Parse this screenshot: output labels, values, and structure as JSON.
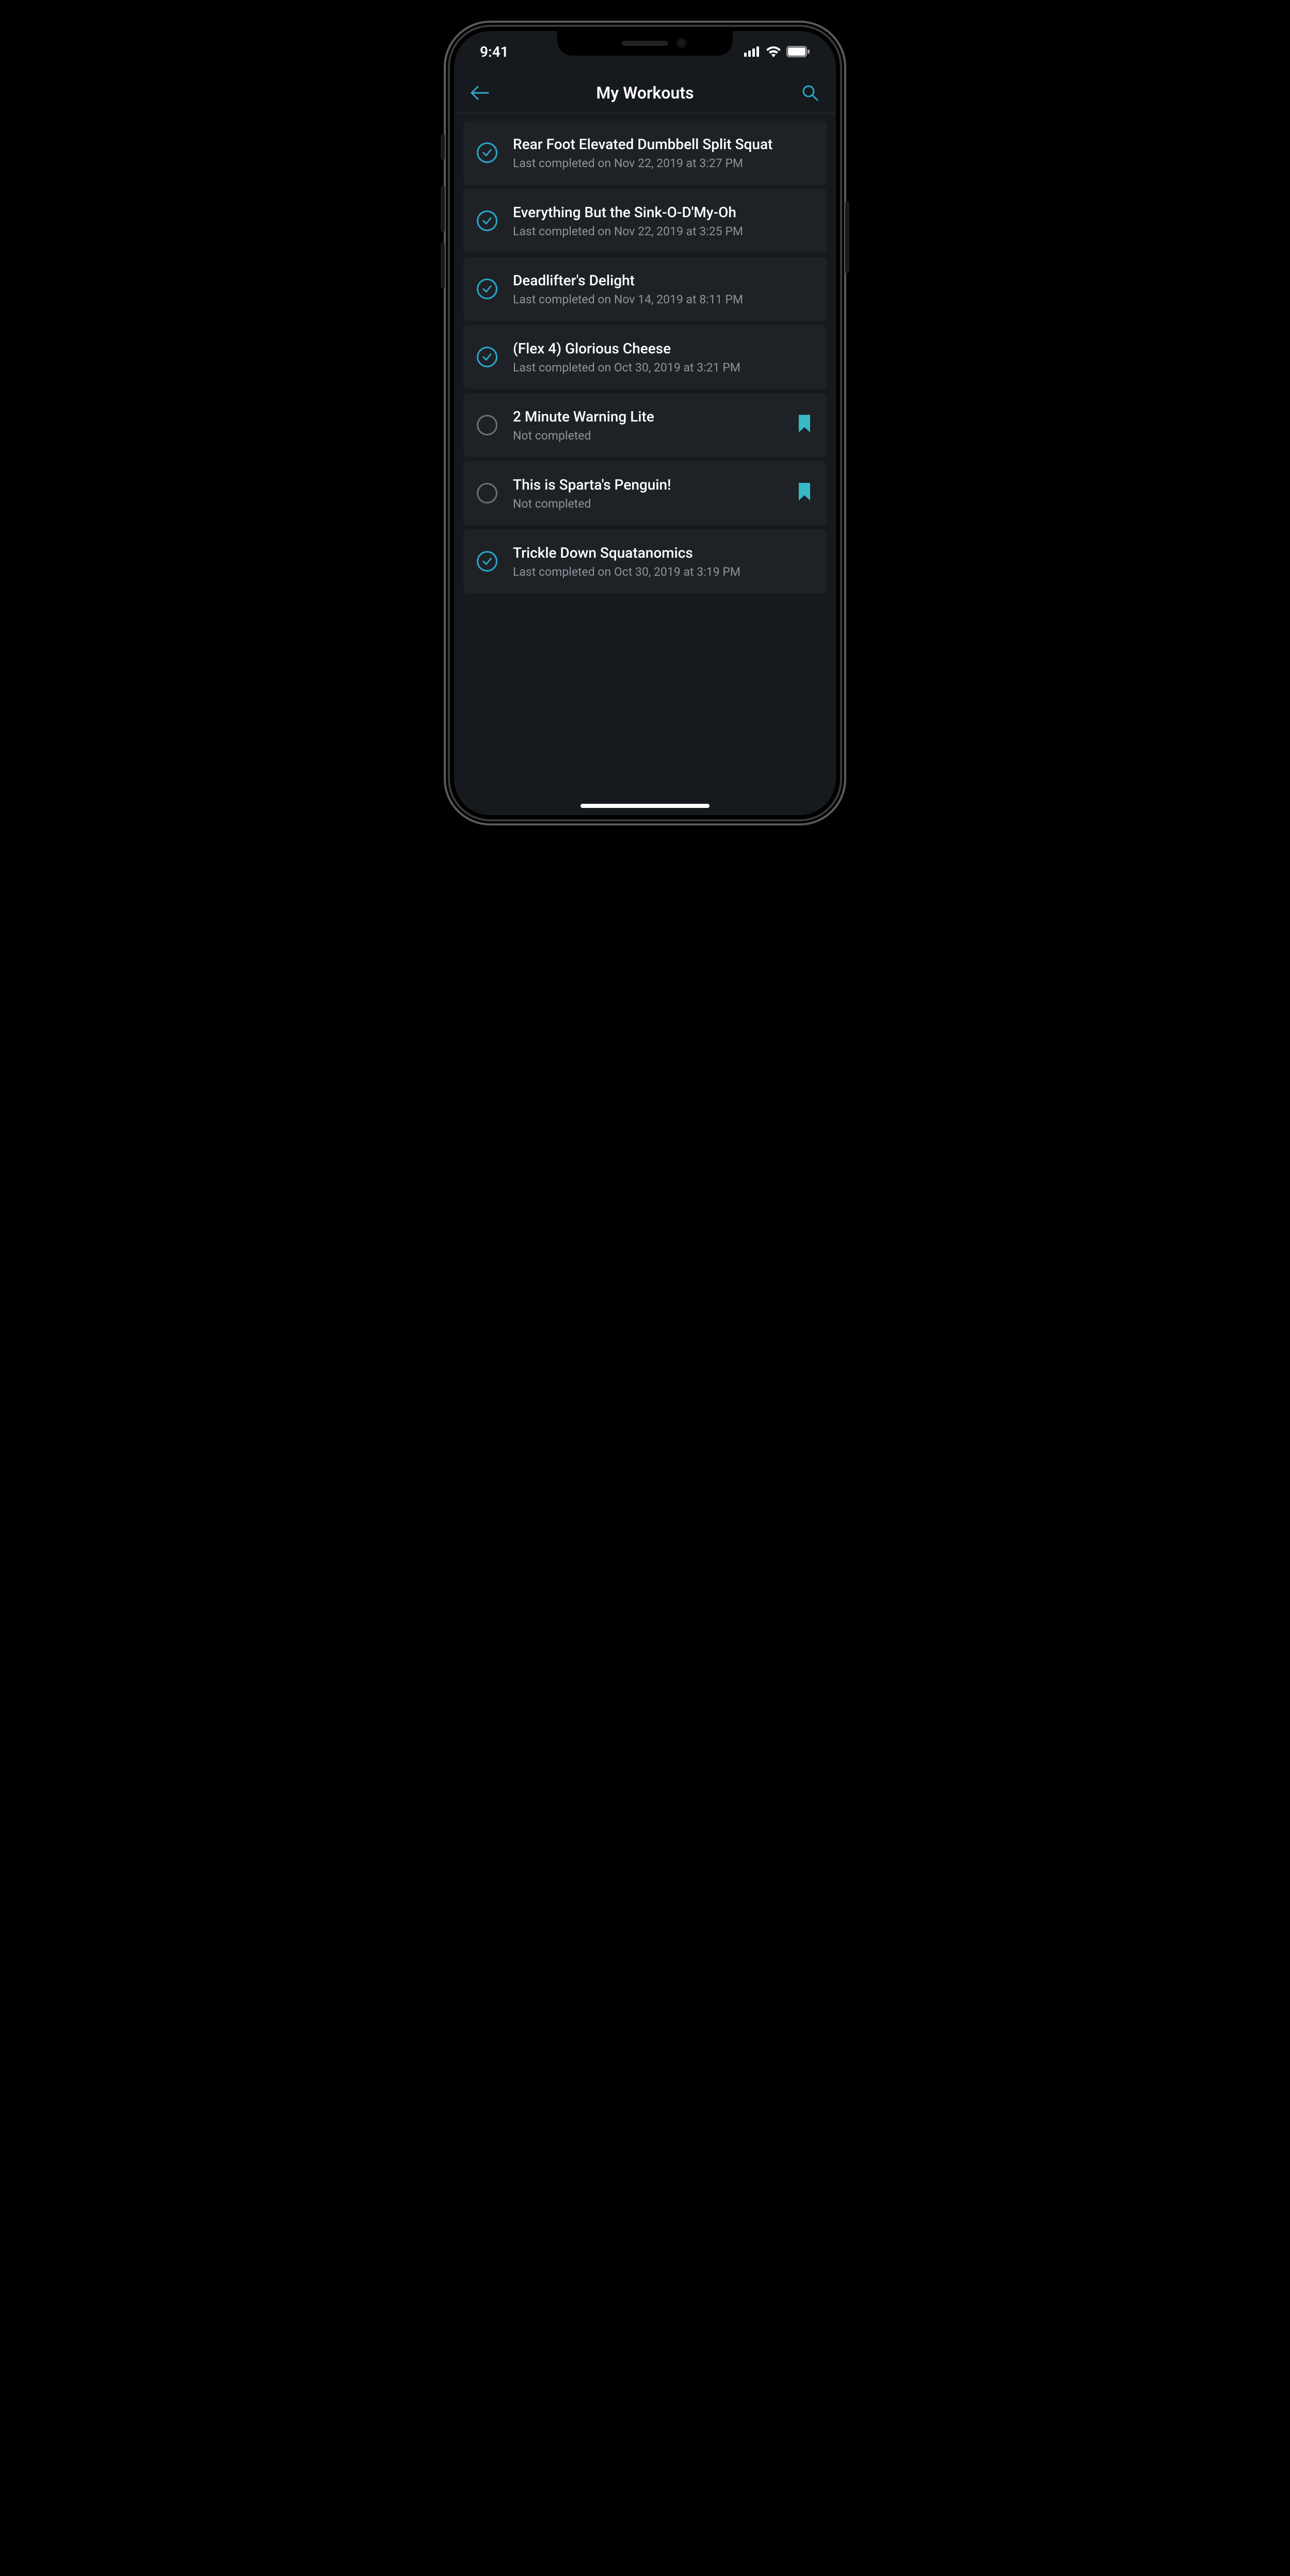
{
  "status_bar": {
    "time": "9:41"
  },
  "header": {
    "title": "My Workouts"
  },
  "workouts": [
    {
      "title": "Rear Foot Elevated Dumbbell Split Squat",
      "subtitle": "Last completed on Nov 22, 2019 at 3:27 PM",
      "completed": true,
      "bookmarked": false
    },
    {
      "title": "Everything But the Sink-O-D'My-Oh",
      "subtitle": "Last completed on Nov 22, 2019 at 3:25 PM",
      "completed": true,
      "bookmarked": false
    },
    {
      "title": "Deadlifter's Delight",
      "subtitle": "Last completed on Nov 14, 2019 at 8:11 PM",
      "completed": true,
      "bookmarked": false
    },
    {
      "title": "(Flex 4) Glorious Cheese",
      "subtitle": "Last completed on Oct 30, 2019 at 3:21 PM",
      "completed": true,
      "bookmarked": false
    },
    {
      "title": "2 Minute Warning Lite",
      "subtitle": "Not completed",
      "completed": false,
      "bookmarked": true
    },
    {
      "title": "This is Sparta's Penguin!",
      "subtitle": "Not completed",
      "completed": false,
      "bookmarked": true
    },
    {
      "title": "Trickle Down Squatanomics",
      "subtitle": "Last completed on Oct 30, 2019 at 3:19 PM",
      "completed": true,
      "bookmarked": false
    }
  ]
}
